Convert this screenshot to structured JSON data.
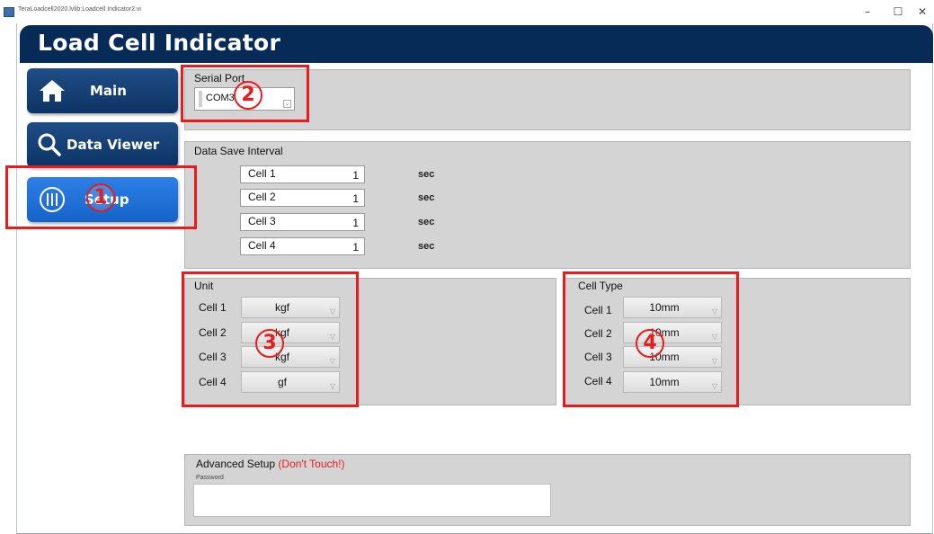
{
  "window": {
    "title": "TeraLoadcell2020.lvlib:Loadcell Indicator2.vi",
    "controls": {
      "minimize": "–",
      "maximize": "☐",
      "close": "✕"
    }
  },
  "header": {
    "title": "Load Cell Indicator"
  },
  "nav": [
    {
      "label": "Main",
      "icon": "home-icon"
    },
    {
      "label": "Data Viewer",
      "icon": "search-icon"
    },
    {
      "label": "Setup",
      "icon": "sliders-icon",
      "active": true
    }
  ],
  "serial_port": {
    "label": "Serial Port",
    "value": "COM3"
  },
  "data_save": {
    "label": "Data Save Interval",
    "unit": "sec",
    "cells": [
      {
        "label": "Cell 1",
        "value": "1"
      },
      {
        "label": "Cell 2",
        "value": "1"
      },
      {
        "label": "Cell 3",
        "value": "1"
      },
      {
        "label": "Cell 4",
        "value": "1"
      }
    ]
  },
  "unit": {
    "label": "Unit",
    "cells": [
      {
        "label": "Cell 1",
        "value": "kgf"
      },
      {
        "label": "Cell 2",
        "value": "kgf"
      },
      {
        "label": "Cell 3",
        "value": "kgf"
      },
      {
        "label": "Cell 4",
        "value": "gf"
      }
    ]
  },
  "cell_type": {
    "label": "Cell Type",
    "cells": [
      {
        "label": "Cell 1",
        "value": "10mm"
      },
      {
        "label": "Cell 2",
        "value": "10mm"
      },
      {
        "label": "Cell 3",
        "value": "10mm"
      },
      {
        "label": "Cell 4",
        "value": "10mm"
      }
    ]
  },
  "advanced": {
    "label": "Advanced Setup",
    "warning": "(Don't Touch!)",
    "password_label": "Password",
    "password_value": ""
  },
  "annotations": [
    "1",
    "2",
    "3",
    "4"
  ],
  "colors": {
    "header_bg": "#062b57",
    "nav_dark": "#0d3465",
    "nav_active": "#1e6fd9",
    "panel_bg": "#d4d4d4",
    "annotation_red": "#e81c1c"
  }
}
